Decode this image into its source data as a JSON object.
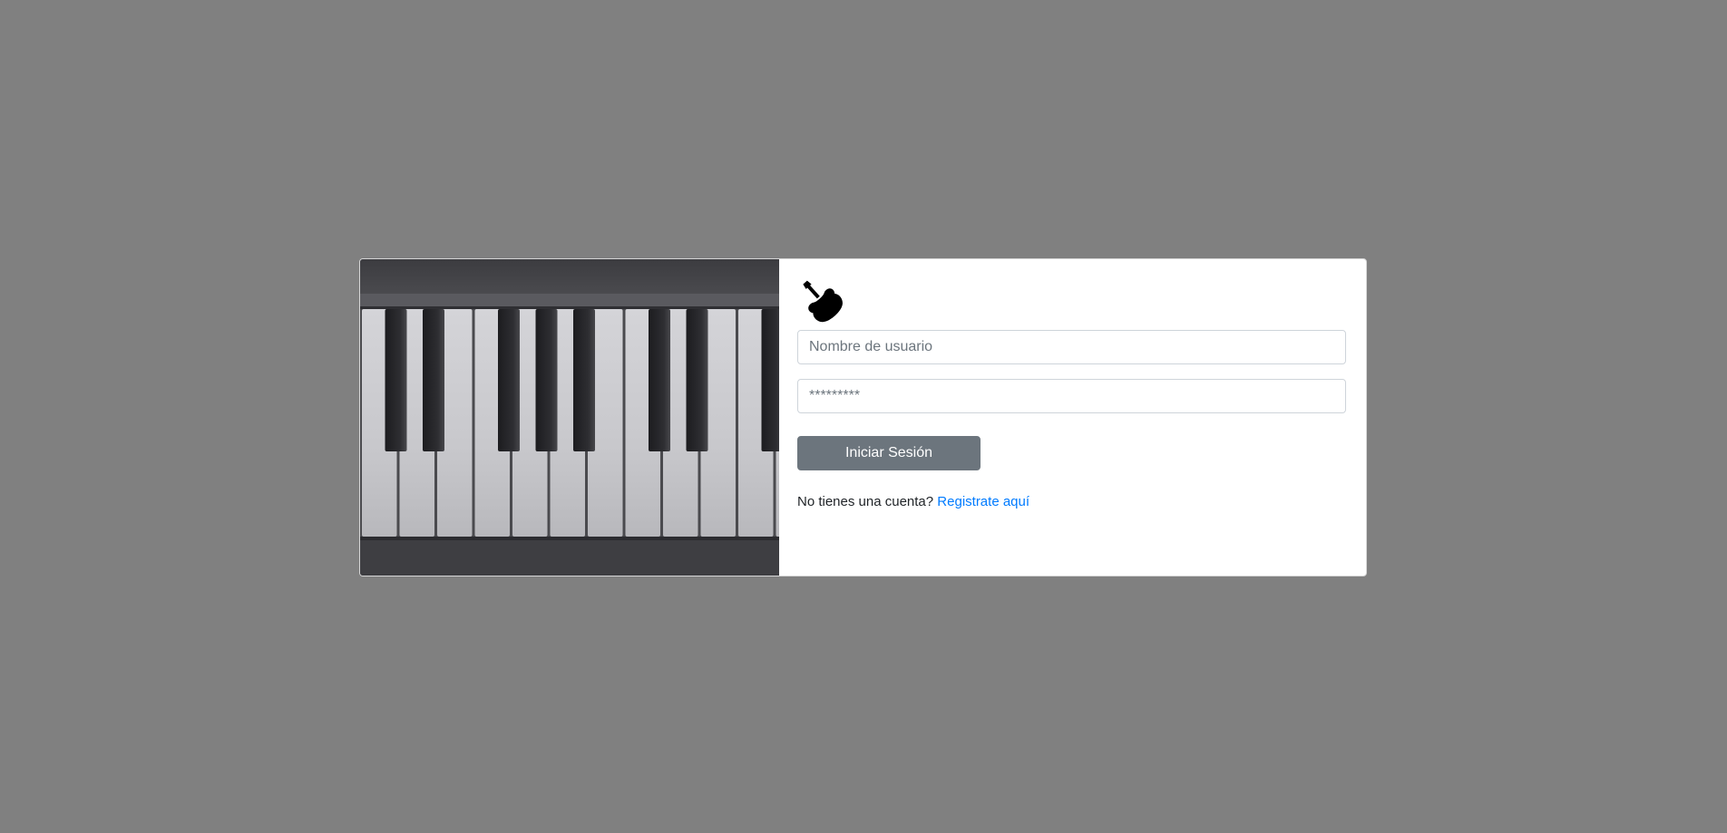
{
  "login": {
    "username_placeholder": "Nombre de usuario",
    "password_placeholder": "*********",
    "submit_label": "Iniciar Sesión",
    "no_account_text": "No tienes una cuenta?",
    "register_link_label": "Registrate aquí"
  },
  "images": {
    "hero": "piano-keys-photo",
    "logo": "electric-guitar-icon"
  },
  "colors": {
    "page_background": "#808080",
    "button": "#6c757d",
    "link": "#007bff"
  }
}
